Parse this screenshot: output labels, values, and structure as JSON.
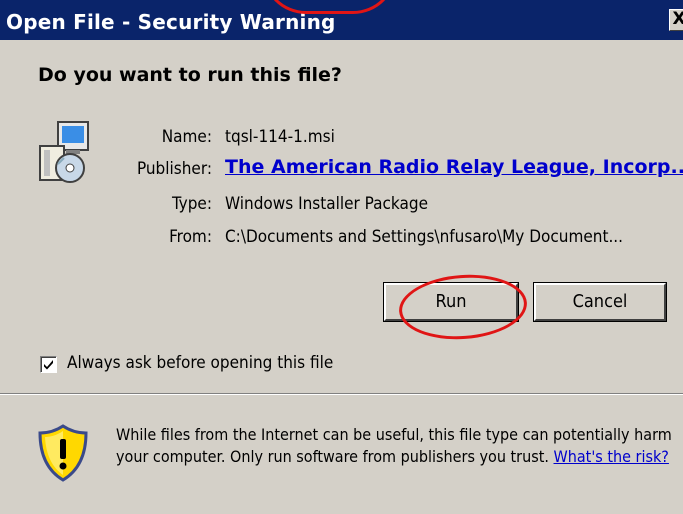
{
  "window": {
    "title": "Open File - Security Warning",
    "close_glyph": "X"
  },
  "dialog": {
    "question": "Do you want to run this file?",
    "file_icon": "installer-package-icon",
    "fields": {
      "name_label": "Name:",
      "name_value": "tqsl-114-1.msi",
      "publisher_label": "Publisher:",
      "publisher_value": "The American Radio Relay League, Incorp...",
      "type_label": "Type:",
      "type_value": "Windows Installer Package",
      "from_label": "From:",
      "from_value": "C:\\Documents and Settings\\nfusaro\\My Document..."
    },
    "buttons": {
      "run": "Run",
      "cancel": "Cancel"
    },
    "checkbox": {
      "label": "Always ask before opening this file",
      "checked": true
    },
    "warning": {
      "icon": "warning-shield-icon",
      "text": "While files from the Internet can be useful, this file type can potentially harm your computer. Only run software from publishers you trust.",
      "link": "What's the risk?"
    }
  },
  "annotations": {
    "highlight_color": "#e01515"
  },
  "colors": {
    "titlebar": "#0a246a",
    "dialog_bg": "#d4d0c8",
    "link": "#0000cc"
  }
}
